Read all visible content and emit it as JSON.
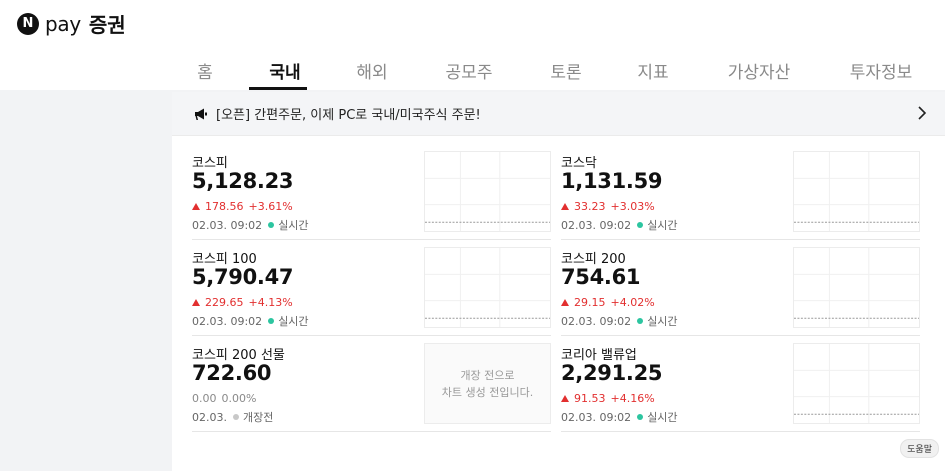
{
  "brand": {
    "mark": "N",
    "pay": "pay",
    "securities": "증권"
  },
  "tabs": [
    {
      "label": "홈"
    },
    {
      "label": "국내",
      "active": true
    },
    {
      "label": "해외"
    },
    {
      "label": "공모주"
    },
    {
      "label": "토론"
    },
    {
      "label": "지표"
    },
    {
      "label": "가상자산"
    },
    {
      "label": "투자정보"
    }
  ],
  "notice": {
    "text": "[오픈] 간편주문, 이제 PC로 국내/미국주식 주문!",
    "icon": "megaphone-icon"
  },
  "indices": [
    {
      "name": "코스피",
      "value": "5,128.23",
      "change": "178.56",
      "rate": "+3.61%",
      "time": "02.03. 09:02",
      "status": "실시간",
      "direction": "up"
    },
    {
      "name": "코스닥",
      "value": "1,131.59",
      "change": "33.23",
      "rate": "+3.03%",
      "time": "02.03. 09:02",
      "status": "실시간",
      "direction": "up"
    },
    {
      "name": "코스피 100",
      "value": "5,790.47",
      "change": "229.65",
      "rate": "+4.13%",
      "time": "02.03. 09:02",
      "status": "실시간",
      "direction": "up"
    },
    {
      "name": "코스피 200",
      "value": "754.61",
      "change": "29.15",
      "rate": "+4.02%",
      "time": "02.03. 09:02",
      "status": "실시간",
      "direction": "up"
    },
    {
      "name": "코스피 200 선물",
      "value": "722.60",
      "change": "0.00",
      "rate": "0.00%",
      "time": "02.03.",
      "status": "개장전",
      "direction": "flat",
      "chart_message_1": "개장 전으로",
      "chart_message_2": "차트 생성 전입니다."
    },
    {
      "name": "코리아 밸류업",
      "value": "2,291.25",
      "change": "91.53",
      "rate": "+4.16%",
      "time": "02.03. 09:02",
      "status": "실시간",
      "direction": "up"
    }
  ],
  "help_label": "도움말",
  "colors": {
    "up": "#e22f2f",
    "live_dot": "#2cc5a0",
    "flat": "#8a8a8a"
  }
}
